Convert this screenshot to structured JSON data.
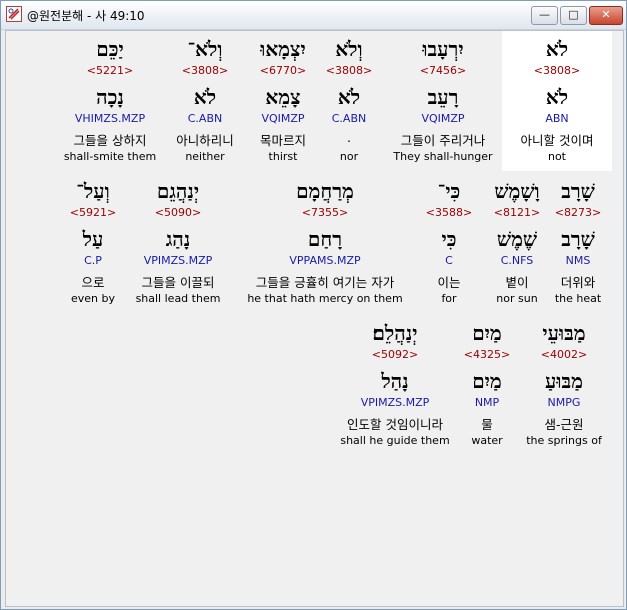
{
  "window": {
    "title": "@원전분해 - 사 49:10",
    "buttons": {
      "minimize": "—",
      "maximize": "□",
      "close": "✕"
    }
  },
  "rows": [
    [
      {
        "top": "לֹא",
        "strong": "<3808>",
        "lex": "לֹא",
        "morph": "ABN",
        "kor": "아니할 것이며",
        "eng": "not",
        "highlight": true
      },
      {
        "top": "יִרְעָבוּ",
        "strong": "<7456>",
        "lex": "רָעֵב",
        "morph": "VQIMZP",
        "kor": "그들이 주리거나",
        "eng": "They shall-hunger"
      },
      {
        "top": "וְלֹא",
        "strong": "<3808>",
        "lex": "לֹא",
        "morph": "C.ABN",
        "kor": ".",
        "eng": "nor"
      },
      {
        "top": "יִצְמָאוּ",
        "strong": "<6770>",
        "lex": "צָמֵא",
        "morph": "VQIMZP",
        "kor": "목마르지",
        "eng": "thirst"
      },
      {
        "top": "וְלֹא־",
        "strong": "<3808>",
        "lex": "לֹא",
        "morph": "C.ABN",
        "kor": "아니하리니",
        "eng": "neither"
      },
      {
        "top": "יַכֵּם",
        "strong": "<5221>",
        "lex": "נָכָה",
        "morph": "VHIMZS.MZP",
        "kor": "그들을 상하지",
        "eng": "shall-smite them"
      }
    ],
    [
      {
        "top": "שָׁרָב",
        "strong": "<8273>",
        "lex": "שָׁרָב",
        "morph": "NMS",
        "kor": "더위와",
        "eng": "the heat"
      },
      {
        "top": "וָשָׁמֶשׁ",
        "strong": "<8121>",
        "lex": "שֶׁמֶשׁ",
        "morph": "C.NFS",
        "kor": "볕이",
        "eng": "nor sun"
      },
      {
        "top": "כִּי־",
        "strong": "<3588>",
        "lex": "כִּי",
        "morph": "C",
        "kor": "이는",
        "eng": "for"
      },
      {
        "top": "מְרַחֲמָם",
        "strong": "<7355>",
        "lex": "רָחַם",
        "morph": "VPPAMS.MZP",
        "kor": "그들을 긍휼히 여기는 자가",
        "eng": "he that hath mercy on them"
      },
      {
        "top": "יְנַהֲגֵם",
        "strong": "<5090>",
        "lex": "נָהַג",
        "morph": "VPIMZS.MZP",
        "kor": "그들을 이끌되",
        "eng": "shall lead them"
      },
      {
        "top": "וְעַל־",
        "strong": "<5921>",
        "lex": "עַל",
        "morph": "C.P",
        "kor": "으로",
        "eng": "even by"
      }
    ],
    [
      {
        "top": "מַבּוּעֵי",
        "strong": "<4002>",
        "lex": "מַבּוּעַ",
        "morph": "NMPG",
        "kor": "샘-근원",
        "eng": "the springs of"
      },
      {
        "top": "מַיִם",
        "strong": "<4325>",
        "lex": "מַיִם",
        "morph": "NMP",
        "kor": "물",
        "eng": "water"
      },
      {
        "top": "יְנַהֲלֵם׃",
        "strong": "<5092>",
        "lex": "נָהַל",
        "morph": "VPIMZS.MZP",
        "kor": "인도할 것임이니라",
        "eng": "shall he guide them"
      }
    ]
  ]
}
